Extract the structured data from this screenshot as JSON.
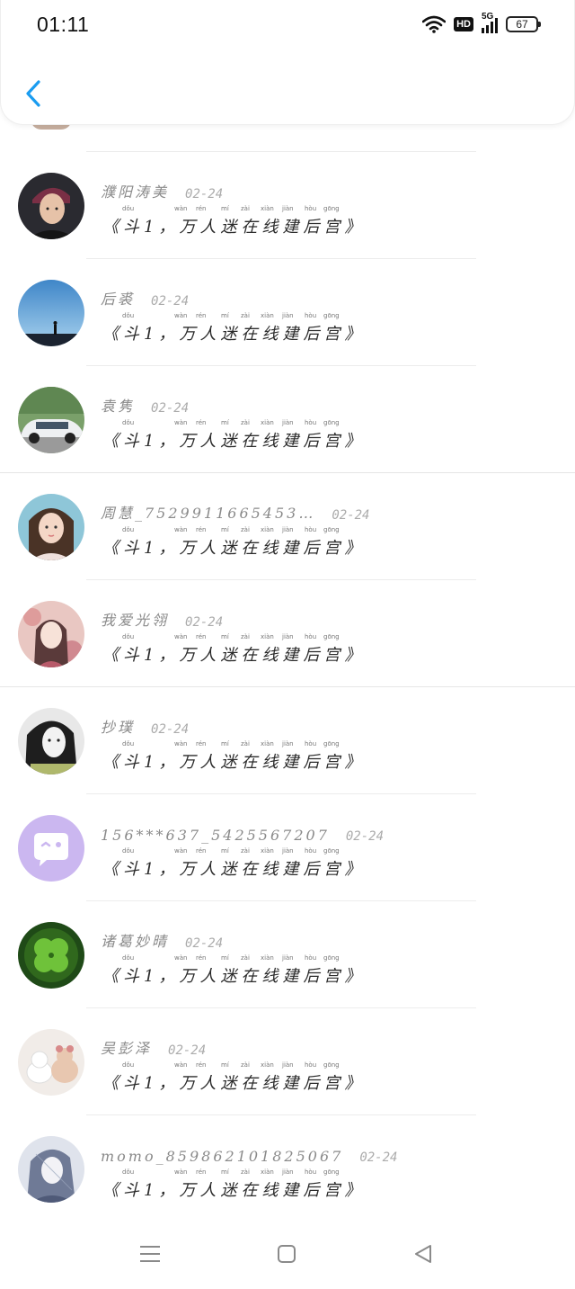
{
  "status_bar": {
    "time": "01:11",
    "network_badge": "HD",
    "network_type": "5G",
    "battery": "67",
    "icons": [
      "wifi-icon",
      "hd-icon",
      "5g-signal-icon",
      "battery-icon"
    ]
  },
  "header": {
    "back_icon": "chevron-left-icon",
    "accent_color": "#1a9cf0"
  },
  "message_pinyin": [
    "dǒu",
    "wàn",
    "rén",
    "mí",
    "zài",
    "xiàn",
    "jiàn",
    "hòu",
    "gōng"
  ],
  "messages": [
    {
      "name": "濮阳涛美",
      "date": "02-24",
      "text": "《斗1，万人迷在线建后宫》",
      "avatar": "portrait-man-icon"
    },
    {
      "name": "后裘",
      "date": "02-24",
      "text": "《斗1，万人迷在线建后宫》",
      "avatar": "landscape-sky-icon"
    },
    {
      "name": "袁隽",
      "date": "02-24",
      "text": "《斗1，万人迷在线建后宫》",
      "avatar": "car-photo-icon"
    },
    {
      "name": "周慧_7529911665453…",
      "date": "02-24",
      "text": "《斗1，万人迷在线建后宫》",
      "avatar": "portrait-girl-icon"
    },
    {
      "name": "我爱光翎",
      "date": "02-24",
      "text": "《斗1，万人迷在线建后宫》",
      "avatar": "anime-girl-icon"
    },
    {
      "name": "抄璞",
      "date": "02-24",
      "text": "《斗1，万人迷在线建后宫》",
      "avatar": "portrait-woman-icon"
    },
    {
      "name": "156***637_5425567207",
      "date": "02-24",
      "text": "《斗1，万人迷在线建后宫》",
      "avatar": "chat-bubble-icon"
    },
    {
      "name": "诸葛妙晴",
      "date": "02-24",
      "text": "《斗1，万人迷在线建后宫》",
      "avatar": "clover-icon"
    },
    {
      "name": "吴彭泽",
      "date": "02-24",
      "text": "《斗1，万人迷在线建后宫》",
      "avatar": "plush-toys-icon"
    },
    {
      "name": "momo_859862101825067",
      "date": "02-24",
      "text": "《斗1，万人迷在线建后宫》",
      "avatar": "anime-sketch-icon"
    }
  ],
  "bottom_nav": {
    "icons": [
      "menu-icon",
      "home-icon",
      "back-triangle-icon"
    ]
  }
}
